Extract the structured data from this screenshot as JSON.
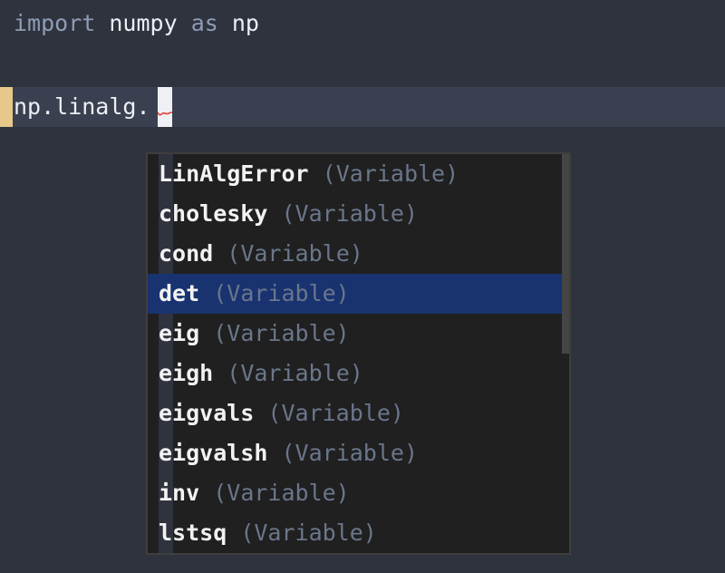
{
  "editor": {
    "line1": {
      "keyword_import": "import",
      "module": "numpy",
      "keyword_as": "as",
      "alias": "np"
    },
    "line3": {
      "code": "np.linalg."
    },
    "colors": {
      "background": "#2f333e",
      "current_line": "#3b4050",
      "keyword": "#8e9cb5",
      "error_underline": "#e0443a"
    }
  },
  "completion": {
    "selected_index": 3,
    "items": [
      {
        "name": "LinAlgError",
        "type": "(Variable)"
      },
      {
        "name": "cholesky",
        "type": "(Variable)"
      },
      {
        "name": "cond",
        "type": "(Variable)"
      },
      {
        "name": "det",
        "type": "(Variable)"
      },
      {
        "name": "eig",
        "type": "(Variable)"
      },
      {
        "name": "eigh",
        "type": "(Variable)"
      },
      {
        "name": "eigvals",
        "type": "(Variable)"
      },
      {
        "name": "eigvalsh",
        "type": "(Variable)"
      },
      {
        "name": "inv",
        "type": "(Variable)"
      },
      {
        "name": "lstsq",
        "type": "(Variable)"
      }
    ],
    "colors": {
      "selection": "#193370",
      "type_text": "#6a768b"
    }
  }
}
